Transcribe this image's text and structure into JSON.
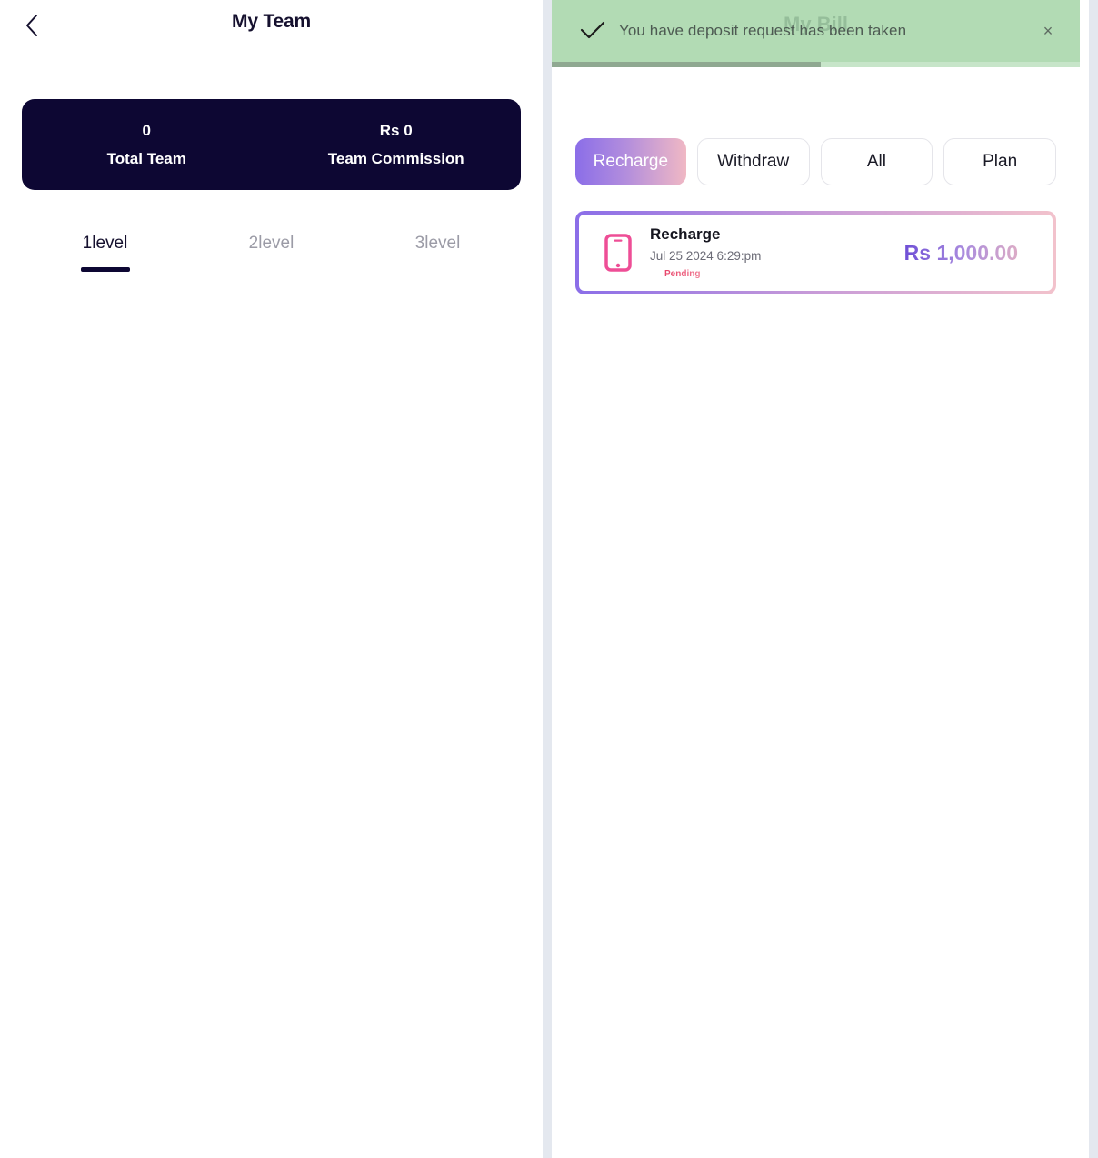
{
  "left_panel": {
    "back_icon": "chevron-left-icon",
    "title": "My Team",
    "stats": [
      {
        "value": "0",
        "label": "Total Team"
      },
      {
        "value": "Rs 0",
        "label": "Team Commission"
      }
    ],
    "level_tabs": [
      {
        "label": "1level",
        "active": true
      },
      {
        "label": "2level",
        "active": false
      },
      {
        "label": "3level",
        "active": false
      }
    ],
    "colors": {
      "card_bg": "#0d0733",
      "active_tab": "#15102e",
      "inactive_tab": "#9b9ba6"
    }
  },
  "right_panel": {
    "title": "My Bill",
    "toast": {
      "icon": "check-icon",
      "message": "You have deposit request has been taken",
      "close_icon": "close-icon",
      "close_label": "×",
      "progress_percent": 51,
      "bg_color": "#a7d6aa",
      "progress_color": "#8fa891"
    },
    "filters": [
      {
        "label": "Recharge",
        "active": true
      },
      {
        "label": "Withdraw",
        "active": false
      },
      {
        "label": "All",
        "active": false
      },
      {
        "label": "Plan",
        "active": false
      }
    ],
    "transactions": [
      {
        "icon": "mobile-phone-icon",
        "title": "Recharge",
        "date": "Jul 25 2024 6:29:pm",
        "status": "Pending",
        "amount": "Rs 1,000.00"
      }
    ],
    "colors": {
      "accent_start": "#8b6ee8",
      "accent_end": "#f0b8c4",
      "status_color": "#e8456b",
      "icon_color": "#ee4e96"
    }
  }
}
